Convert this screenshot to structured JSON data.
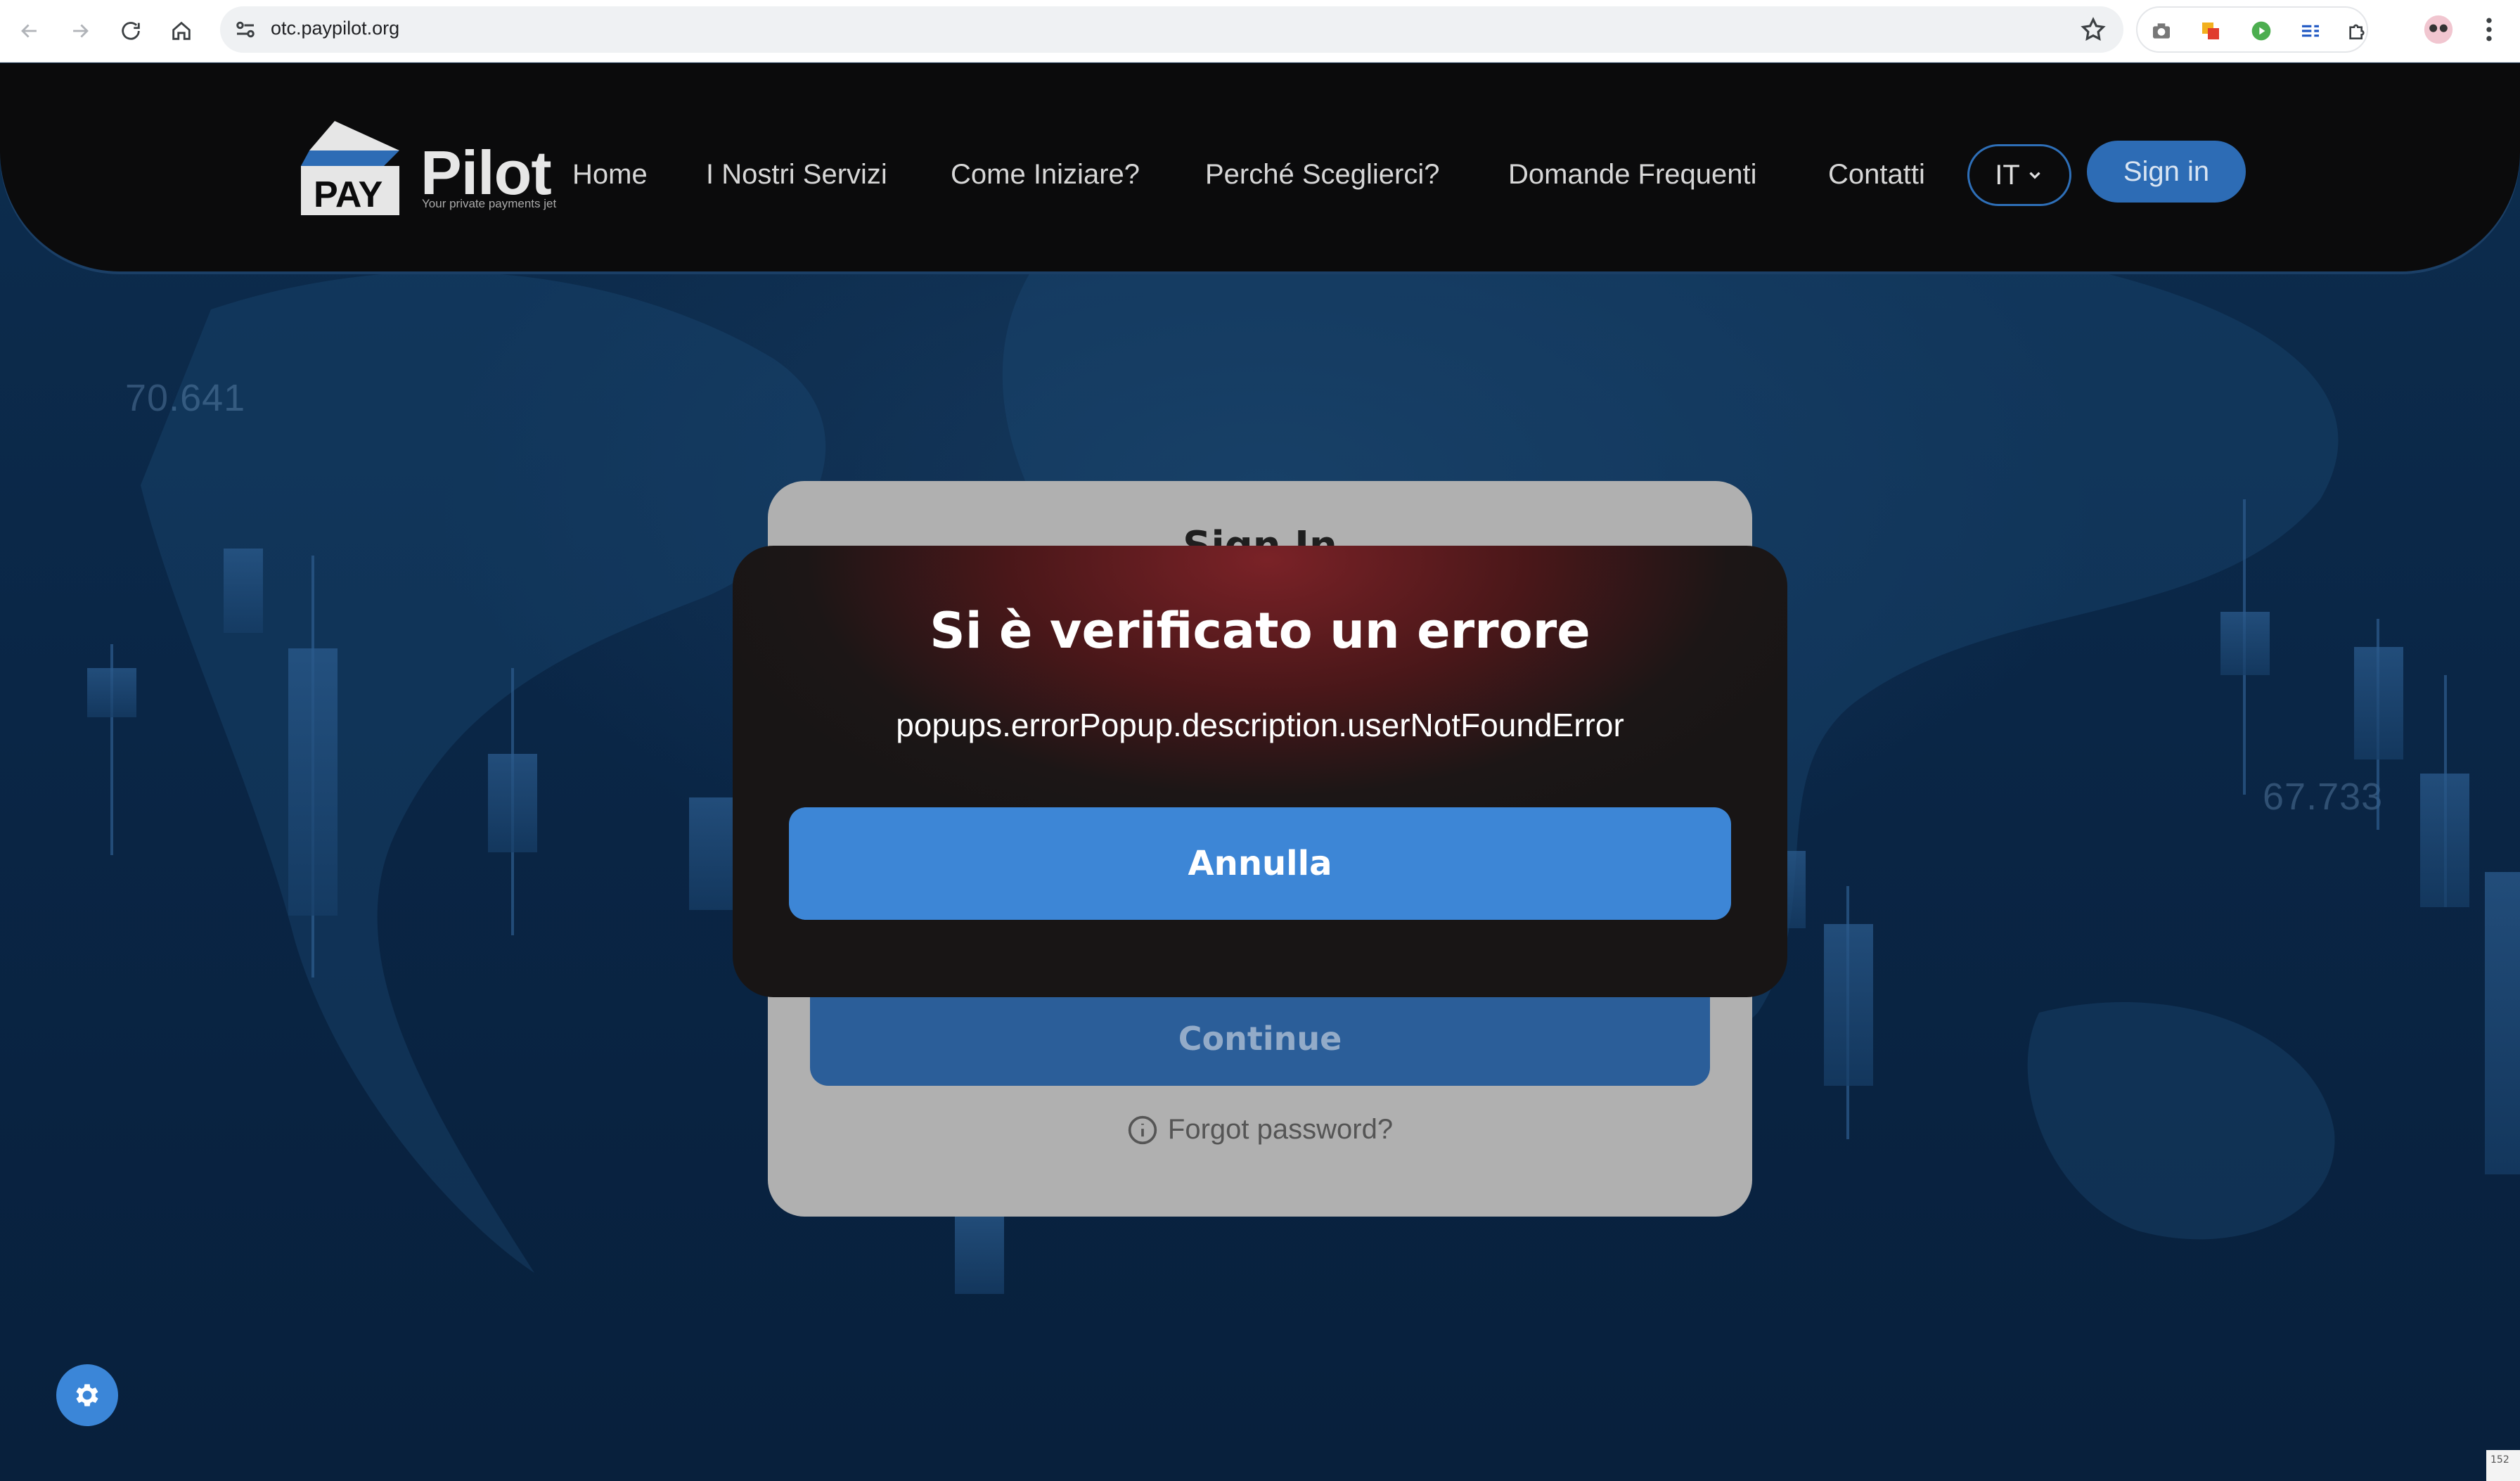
{
  "browser": {
    "url": "otc.paypilot.org",
    "back_icon": "arrow-left-icon",
    "forward_icon": "arrow-right-icon",
    "reload_icon": "reload-icon",
    "home_icon": "home-icon",
    "bookmark_icon": "star-icon",
    "menu_icon": "more-vert-icon"
  },
  "header": {
    "logo_text": "Pilot",
    "logo_badge": "PAY",
    "logo_tagline": "Your private payments jet",
    "menu": [
      {
        "label": "Home"
      },
      {
        "label": "I Nostri Servizi"
      },
      {
        "label": "Come Iniziare?"
      },
      {
        "label": "Perché Sceglierci?"
      },
      {
        "label": "Domande Frequenti"
      },
      {
        "label": "Contatti"
      }
    ],
    "language": "IT",
    "signin_label": "Sign in"
  },
  "background": {
    "ticker_left": "70.641",
    "ticker_right": "67.733"
  },
  "login_card": {
    "title": "Sign In",
    "continue_label": "Continue",
    "forgot_label": "Forgot password?"
  },
  "error_popup": {
    "title": "Si è verificato un errore",
    "description": "popups.errorPopup.description.userNotFoundError",
    "cancel_label": "Annulla"
  },
  "corner_text": "152",
  "colors": {
    "accent": "#3d86d6",
    "header_bg": "#0b0b0c",
    "popup_red": "#7a2227"
  }
}
